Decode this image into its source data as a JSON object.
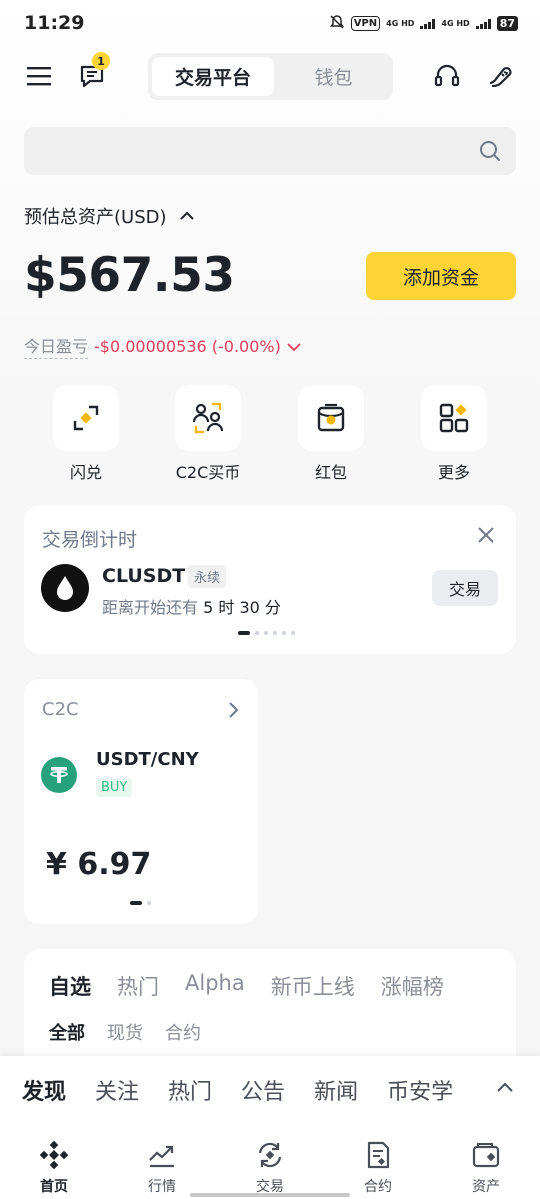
{
  "status_bar": {
    "time": "11:29",
    "vpn": "VPN",
    "net1": "4G HD",
    "net2": "4G HD",
    "battery": "87"
  },
  "header": {
    "notification_count": "1",
    "tabs": [
      {
        "label": "交易平台",
        "active": true
      },
      {
        "label": "钱包",
        "active": false
      }
    ]
  },
  "balance": {
    "label": "预估总资产(USD)",
    "value": "$567.53",
    "add_funds": "添加资金",
    "pnl_label": "今日盈亏",
    "pnl_value": "-$0.00000536 (-0.00%)"
  },
  "shortcuts": [
    {
      "label": "闪兑",
      "icon": "convert-icon"
    },
    {
      "label": "C2C买币",
      "icon": "p2p-icon"
    },
    {
      "label": "红包",
      "icon": "red-packet-icon"
    },
    {
      "label": "更多",
      "icon": "more-icon"
    }
  ],
  "countdown": {
    "title": "交易倒计时",
    "symbol": "CLUSDT",
    "tag": "永续",
    "sub_prefix": "距离开始还有",
    "sub_time": "5 时 30 分",
    "trade_button": "交易",
    "pages": 6,
    "active_page": 1
  },
  "c2c": {
    "header": "C2C",
    "pair": "USDT/CNY",
    "side": "BUY",
    "price": "¥ 6.97",
    "pages": 2,
    "active_page": 1
  },
  "market": {
    "tabs": [
      {
        "label": "自选",
        "active": true
      },
      {
        "label": "热门",
        "active": false
      },
      {
        "label": "Alpha",
        "active": false
      },
      {
        "label": "新币上线",
        "active": false
      },
      {
        "label": "涨幅榜",
        "active": false
      }
    ],
    "subtabs": [
      {
        "label": "全部",
        "active": true
      },
      {
        "label": "现货",
        "active": false
      },
      {
        "label": "合约",
        "active": false
      }
    ]
  },
  "discover": {
    "items": [
      {
        "label": "发现",
        "active": true
      },
      {
        "label": "关注",
        "active": false
      },
      {
        "label": "热门",
        "active": false
      },
      {
        "label": "公告",
        "active": false
      },
      {
        "label": "新闻",
        "active": false
      },
      {
        "label": "币安学",
        "active": false
      }
    ]
  },
  "nav": [
    {
      "label": "首页",
      "icon": "home-icon",
      "active": true
    },
    {
      "label": "行情",
      "icon": "markets-icon",
      "active": false
    },
    {
      "label": "交易",
      "icon": "trade-icon",
      "active": false
    },
    {
      "label": "合约",
      "icon": "futures-icon",
      "active": false
    },
    {
      "label": "资产",
      "icon": "assets-icon",
      "active": false
    }
  ],
  "colors": {
    "accent": "#FCD535",
    "negative": "#E23C5C",
    "positive": "#2EBD85",
    "tether": "#26A17B"
  }
}
